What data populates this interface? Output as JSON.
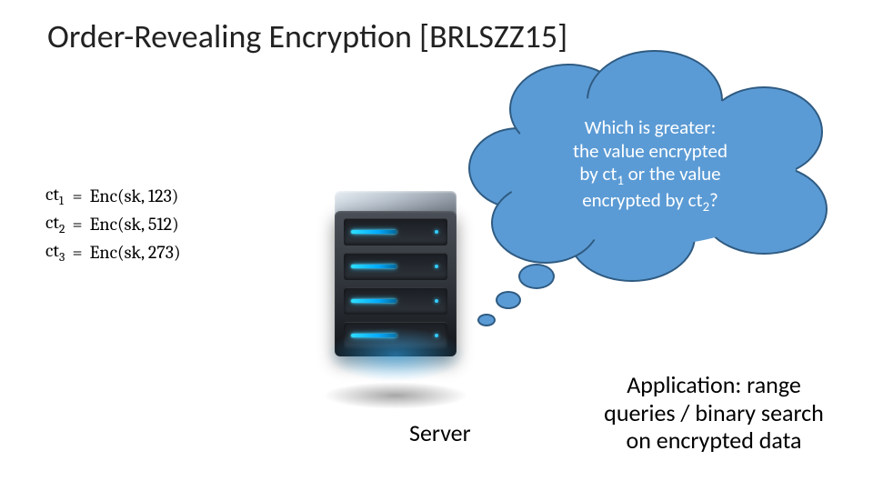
{
  "title": "Order-Revealing Encryption [BRLSZZ15]",
  "equations": {
    "rows": [
      {
        "lhs_sym": "ct",
        "lhs_sub": "1",
        "eq": "=",
        "rhs": "Enc(sk, 123)"
      },
      {
        "lhs_sym": "ct",
        "lhs_sub": "2",
        "eq": "=",
        "rhs": "Enc(sk, 512)"
      },
      {
        "lhs_sym": "ct",
        "lhs_sub": "3",
        "eq": "=",
        "rhs": "Enc(sk, 273)"
      }
    ]
  },
  "cloud": {
    "line1": "Which is greater:",
    "line2": "the value encrypted",
    "line3_pre": "by ",
    "line3_sym": "ct",
    "line3_sub": "1",
    "line3_post": " or the value",
    "line4_pre": "encrypted by ",
    "line4_sym": "ct",
    "line4_sub": "2",
    "line4_post": "?"
  },
  "server_label": "Server",
  "application": {
    "line1": "Application: range",
    "line2": "queries / binary search",
    "line3": "on encrypted data"
  }
}
